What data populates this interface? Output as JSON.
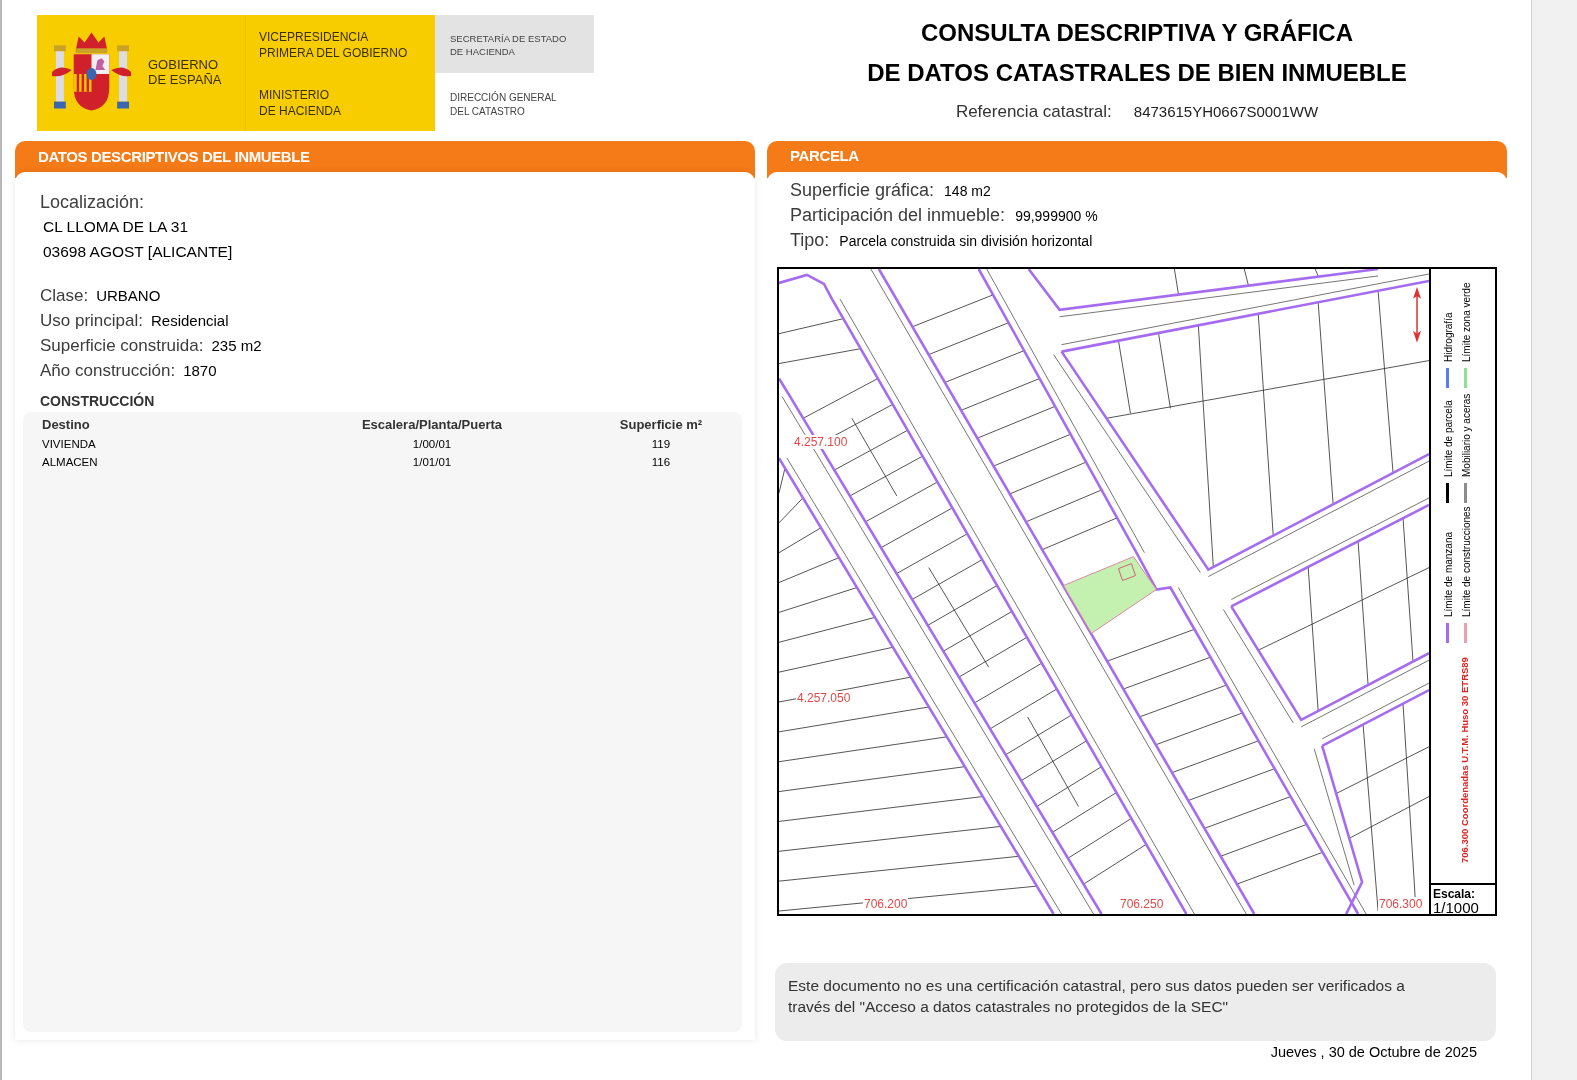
{
  "logo": {
    "government": [
      "GOBIERNO",
      "DE ESPAÑA"
    ],
    "vicepresidency": [
      "VICEPRESIDENCIA",
      "PRIMERA DEL GOBIERNO"
    ],
    "ministry": [
      "MINISTERIO",
      "DE HACIENDA"
    ],
    "secretariat": [
      "SECRETARÍA DE ESTADO",
      "DE HACIENDA"
    ],
    "directorate": [
      "DIRECCIÓN GENERAL",
      "DEL CATASTRO"
    ]
  },
  "title": {
    "lines": [
      "CONSULTA DESCRIPTIVA Y GRÁFICA",
      "DE DATOS CATASTRALES DE BIEN INMUEBLE"
    ],
    "reference_label": "Referencia catastral:",
    "reference_value": "8473615YH0667S0001WW"
  },
  "descriptive_panel": {
    "heading": "DATOS DESCRIPTIVOS DEL INMUEBLE",
    "location_label": "Localización:",
    "address_lines": [
      "CL LLOMA DE LA 31",
      "03698 AGOST [ALICANTE]"
    ],
    "fields": [
      {
        "label": "Clase:",
        "value": "URBANO"
      },
      {
        "label": "Uso principal:",
        "value": "Residencial"
      },
      {
        "label": "Superficie construida:",
        "value": "235 m2"
      },
      {
        "label": "Año construcción:",
        "value": "1870"
      }
    ],
    "construction": {
      "heading": "CONSTRUCCIÓN",
      "columns": [
        "Destino",
        "Escalera/Planta/Puerta",
        "Superficie m²"
      ],
      "rows": [
        [
          "VIVIENDA",
          "1/00/01",
          "119"
        ],
        [
          "ALMACEN",
          "1/01/01",
          "116"
        ]
      ]
    }
  },
  "parcel_panel": {
    "heading": "PARCELA",
    "fields": [
      {
        "label": "Superficie gráfica:",
        "value": "148 m2"
      },
      {
        "label": "Participación del inmueble:",
        "value": "99,999900 %"
      },
      {
        "label": "Tipo:",
        "value": "Parcela construida sin división horizontal"
      }
    ],
    "map": {
      "coordinates": [
        {
          "kind": "northing",
          "label": "4.257.100"
        },
        {
          "kind": "northing",
          "label": "4.257.050"
        },
        {
          "kind": "easting",
          "label": "706.200"
        },
        {
          "kind": "easting",
          "label": "706.250"
        },
        {
          "kind": "easting",
          "label": "706.300"
        }
      ],
      "legend_columns": [
        [
          {
            "label": "Límite de manzana",
            "color": "#a56cf0"
          },
          {
            "label": "Límite de parcela",
            "color": "#000000"
          },
          {
            "label": "Hidrografía",
            "color": "#5b7cf0"
          }
        ],
        [
          {
            "label": "Límite de construcciones",
            "color": "#e8a0b4"
          },
          {
            "label": "Mobiliario y aceras",
            "color": "#8c8c8c"
          },
          {
            "label": "Límite zona verde",
            "color": "#8fe08f"
          }
        ]
      ],
      "crs_note": "706.300 Coordenadas U.T.M. Huso 30 ETRS89",
      "scale_label": "Escala:",
      "scale_value": "1/1000"
    }
  },
  "note": "Este documento no es una certificación catastral, pero sus datos pueden ser verificados a través del \"Acceso a datos catastrales no protegidos de la SEC\"",
  "date": "Jueves , 30 de Octubre de 2025"
}
